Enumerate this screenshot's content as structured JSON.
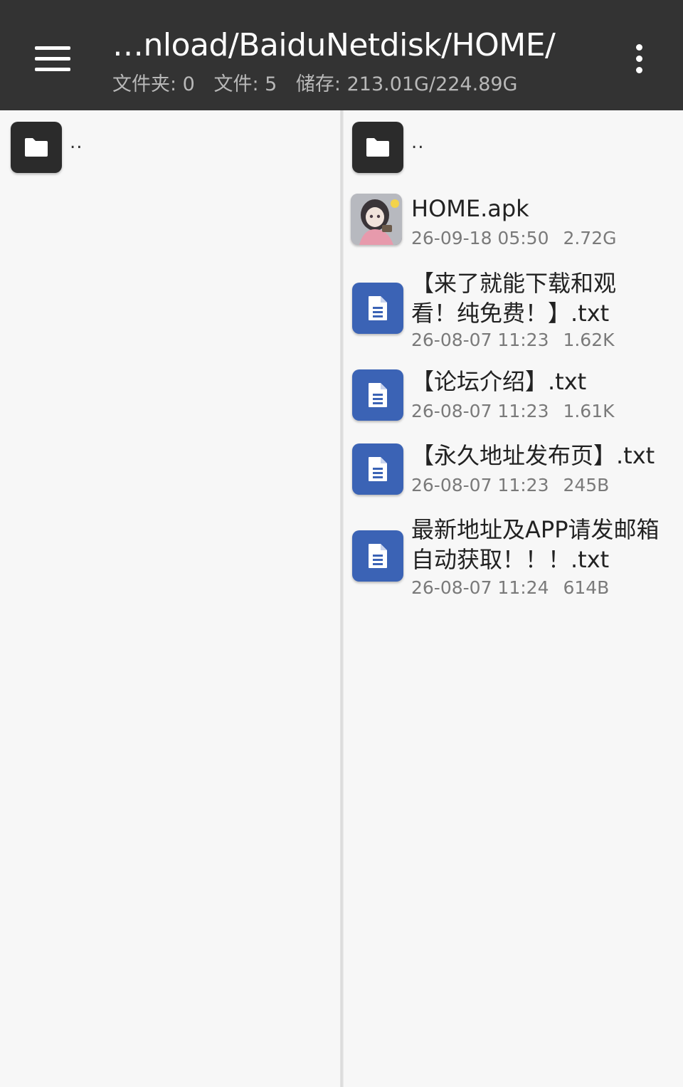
{
  "appbar": {
    "title": "…nload/BaiduNetdisk/HOME/",
    "folders_label": "文件夹: 0",
    "files_label": "文件: 5",
    "storage_label": "储存: 213.01G/224.89G",
    "background": "#333333"
  },
  "left_pane": {
    "parent_label": ".."
  },
  "right_pane": {
    "parent_label": "..",
    "files": [
      {
        "name": "HOME.apk",
        "date": "26-09-18 05:50",
        "size": "2.72G",
        "icon": "apk-thumbnail-icon"
      },
      {
        "name": "【来了就能下载和观看！纯免费！】.txt",
        "date": "26-08-07 11:23",
        "size": "1.62K",
        "icon": "text-file-icon"
      },
      {
        "name": "【论坛介绍】.txt",
        "date": "26-08-07 11:23",
        "size": "1.61K",
        "icon": "text-file-icon"
      },
      {
        "name": "【永久地址发布页】.txt",
        "date": "26-08-07 11:23",
        "size": "245B",
        "icon": "text-file-icon"
      },
      {
        "name": "最新地址及APP请发邮箱自动获取！！！.txt",
        "date": "26-08-07 11:24",
        "size": "614B",
        "icon": "text-file-icon"
      }
    ]
  },
  "colors": {
    "folder_icon_bg": "#2b2b2b",
    "doc_icon_bg": "#3b63b5",
    "pane_bg": "#f7f7f7"
  }
}
